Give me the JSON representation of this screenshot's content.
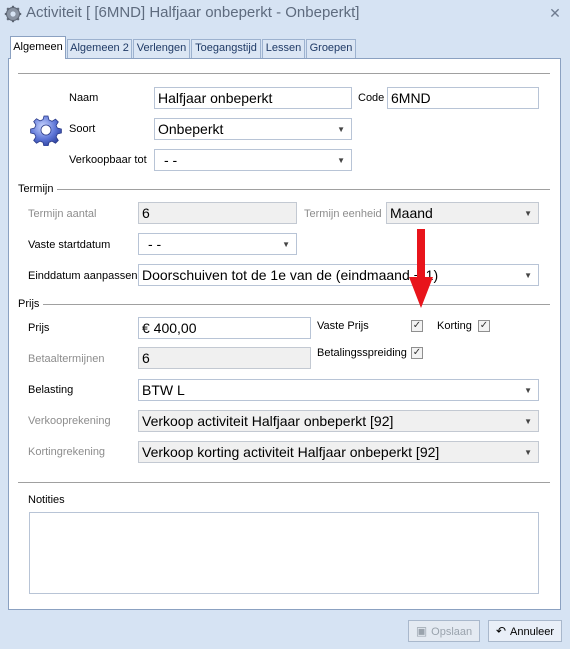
{
  "window": {
    "title": "Activiteit [ [6MND] Halfjaar onbeperkt - Onbeperkt]",
    "close_glyph": "✕",
    "app_icon": "gear-icon"
  },
  "tabs": [
    {
      "label": "Algemeen",
      "active": true
    },
    {
      "label": "Algemeen 2",
      "active": false
    },
    {
      "label": "Verlengen",
      "active": false
    },
    {
      "label": "Toegangstijd",
      "active": false
    },
    {
      "label": "Lessen",
      "active": false
    },
    {
      "label": "Groepen",
      "active": false
    }
  ],
  "general": {
    "naam_label": "Naam",
    "naam_value": "Halfjaar onbeperkt",
    "code_label": "Code",
    "code_value": "6MND",
    "soort_label": "Soort",
    "soort_value": "Onbeperkt",
    "verkoopbaar_label": "Verkoopbaar tot",
    "verkoopbaar_value": "-  -"
  },
  "termijn": {
    "section_label": "Termijn",
    "aantal_label": "Termijn aantal",
    "aantal_value": "6",
    "eenheid_label": "Termijn eenheid",
    "eenheid_value": "Maand",
    "startdatum_label": "Vaste startdatum",
    "startdatum_value": "-  -",
    "einddatum_label": "Einddatum aanpassen",
    "einddatum_value": "Doorschuiven tot de 1e van de (eindmaand + 1)"
  },
  "prijs": {
    "section_label": "Prijs",
    "prijs_label": "Prijs",
    "prijs_value": "€ 400,00",
    "vaste_prijs_label": "Vaste Prijs",
    "vaste_prijs_checked": true,
    "korting_label": "Korting",
    "korting_checked": true,
    "betaaltermijnen_label": "Betaaltermijnen",
    "betaaltermijnen_value": "6",
    "spreiding_label": "Betalingsspreiding",
    "spreiding_checked": true,
    "belasting_label": "Belasting",
    "belasting_value": "BTW L",
    "verkooprekening_label": "Verkooprekening",
    "verkooprekening_value": "Verkoop activiteit Halfjaar onbeperkt  [92]",
    "kortingrekening_label": "Kortingrekening",
    "kortingrekening_value": "Verkoop korting activiteit Halfjaar onbeperkt  [92]"
  },
  "notities": {
    "label": "Notities",
    "value": ""
  },
  "buttons": {
    "save_label": "Opslaan",
    "cancel_label": "Annuleer"
  },
  "check_glyph": "✓",
  "caret_glyph": "▼",
  "colors": {
    "window_bg": "#d6e3f3",
    "annotation_arrow": "#e8141b"
  }
}
